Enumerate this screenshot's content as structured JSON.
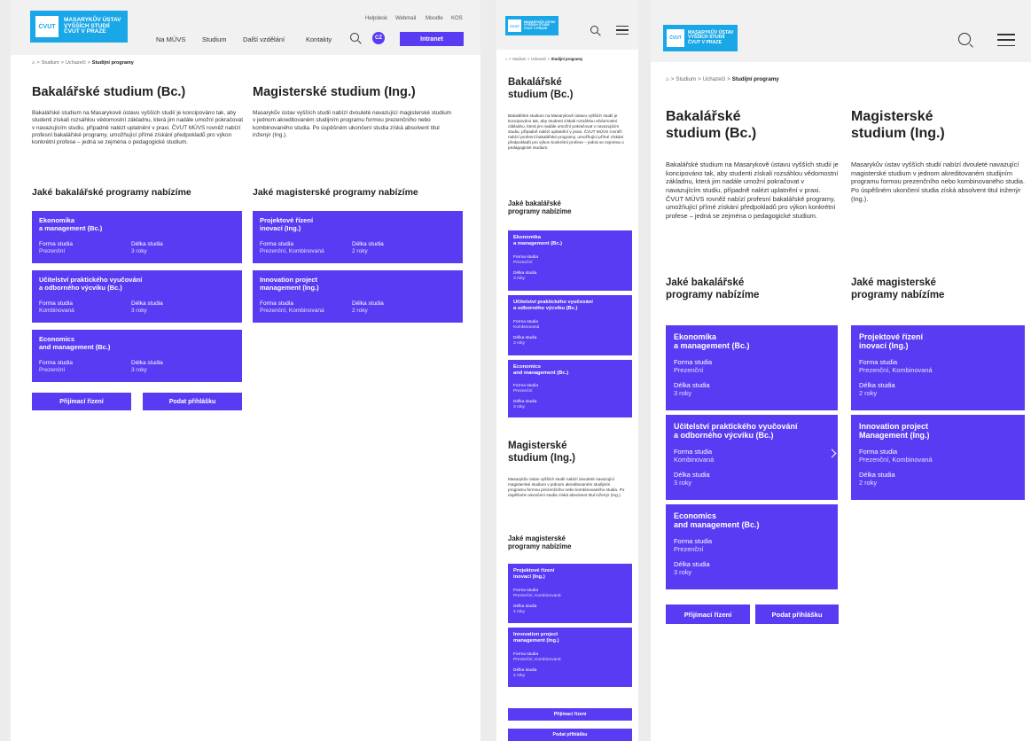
{
  "logo": {
    "line1": "MASARYKŮV ÚSTAV",
    "line2": "VYŠŠÍCH STUDIÍ",
    "line3": "ČVUT V PRAZE",
    "mark": "ĆVUT"
  },
  "toplinks": [
    "Helpdesk",
    "Webmail",
    "Moodle",
    "KOS"
  ],
  "nav": [
    "Na MÚVS",
    "Studium",
    "Další vzdělání",
    "Kontakty"
  ],
  "lang": "CZ",
  "intranet": "Intranet",
  "breadcrumb": {
    "sep": ">",
    "items": [
      "Studium",
      "Uchazeči"
    ],
    "current": "Studijní programy"
  },
  "bachelor": {
    "title": "Bakalářské studium (Bc.)",
    "title_a": "Bakalářské",
    "title_b": "studium (Bc.)",
    "text": "Bakalářské studium na Masarykově ústavu vyšších studií je koncipováno tak, aby studenti získali rozsáhlou vědomostní základnu, která jim nadále umožní pokračovat v navazujícím studiu, případně nalézt uplatnění v praxi. ČVUT MÚVS rovněž nabízí profesní bakalářské programy, umožňující přímé získání předpokladů pro výkon konkrétní profese – jedná se zejména o pedagogické studium.",
    "programs_heading": "Jaké bakalářské programy nabízíme",
    "programs_heading_a": "Jaké bakalářské",
    "programs_heading_b": "programy nabízíme"
  },
  "master": {
    "title": "Magisterské studium (Ing.)",
    "title_a": "Magisterské",
    "title_b": "studium (Ing.)",
    "text": "Masarykův ústav vyšších studií nabízí dvouleté navazující magisterské studium v jednom akreditovaném studijním programu formou prezenčního nebo kombinovaného studia. Po úspěšném ukončení studia získá absolvent titul inženýr (Ing.).",
    "programs_heading": "Jaké magisterské programy nabízíme",
    "programs_heading_a": "Jaké magisterské",
    "programs_heading_b": "programy nabízíme"
  },
  "labels": {
    "forma": "Forma studia",
    "delka": "Délka studia"
  },
  "bachelor_programs": [
    {
      "title_a": "Ekonomika",
      "title_b": "a management (Bc.)",
      "forma": "Prezenční",
      "delka": "3 roky"
    },
    {
      "title_a": "Učitelství praktického vyučování",
      "title_b": "a odborného výcviku (Bc.)",
      "forma": "Kombinovaná",
      "delka": "3 roky"
    },
    {
      "title_a": "Economics",
      "title_b": "and management (Bc.)",
      "forma": "Prezenční",
      "delka": "3 roky"
    }
  ],
  "master_programs": [
    {
      "title_a": "Projektové řízení",
      "title_b": "inovací (Ing.)",
      "forma": "Prezenční, Kombinovaná",
      "delka": "2 roky"
    },
    {
      "title_a": "Innovation project",
      "title_b": "management (Ing.)",
      "title_b_alt": "Management (Ing.)",
      "forma": "Prezenční, Kombinovaná",
      "delka": "2 roky"
    }
  ],
  "buttons": {
    "admission": "Přijímací řízení",
    "apply": "Podat přihlášku"
  },
  "icons": {
    "home": "home-icon",
    "search": "search-icon",
    "menu": "hamburger-menu-icon",
    "chevron": "chevron-right-icon"
  },
  "colors": {
    "accent": "#5a3bf4",
    "logo": "#1aa7e8",
    "header_bg": "#f1f1f1"
  }
}
